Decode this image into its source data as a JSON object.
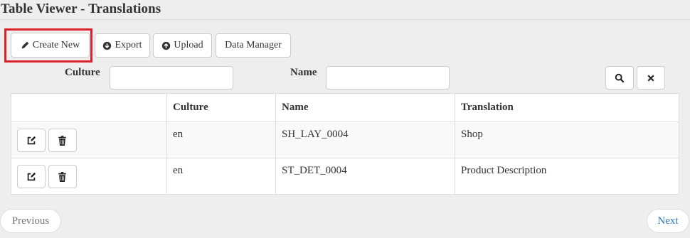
{
  "header": {
    "title": "Table Viewer - Translations"
  },
  "toolbar": {
    "create_label": "Create New",
    "export_label": "Export",
    "upload_label": "Upload",
    "data_manager_label": "Data Manager"
  },
  "filters": {
    "culture_label": "Culture",
    "culture_value": "",
    "name_label": "Name",
    "name_value": ""
  },
  "table": {
    "columns": [
      "",
      "Culture",
      "Name",
      "Translation"
    ],
    "rows": [
      {
        "culture": "en",
        "name": "SH_LAY_0004",
        "translation": "Shop"
      },
      {
        "culture": "en",
        "name": "ST_DET_0004",
        "translation": "Product Description"
      }
    ]
  },
  "pagination": {
    "previous_label": "Previous",
    "next_label": "Next"
  },
  "colors": {
    "highlight": "#e0202a",
    "next_link": "#337ab7"
  },
  "icons": {
    "create": "pencil-icon",
    "export": "download-circle-icon",
    "upload": "upload-circle-icon",
    "search": "search-icon",
    "clear": "close-icon",
    "edit": "edit-icon",
    "delete": "trash-icon"
  }
}
